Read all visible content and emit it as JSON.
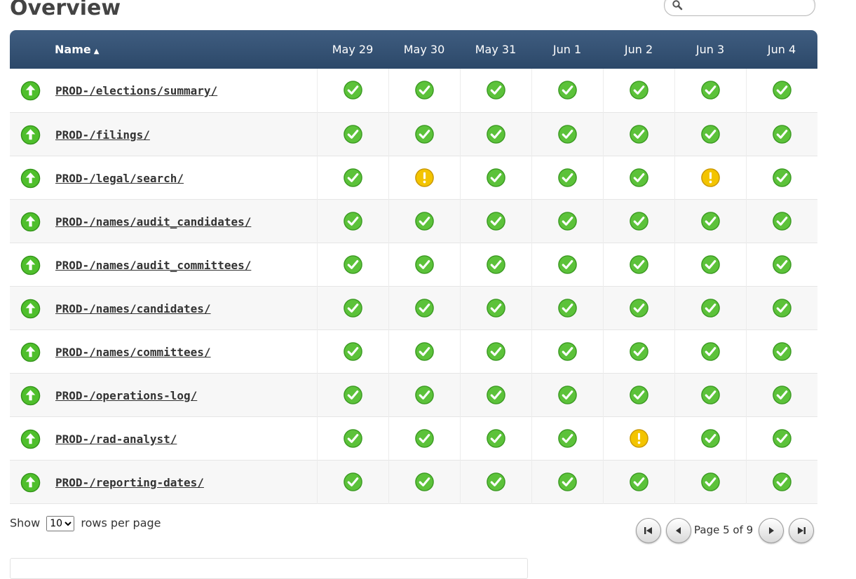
{
  "page": {
    "title": "Overview"
  },
  "search": {
    "placeholder": "",
    "value": ""
  },
  "table": {
    "name_header": "Name",
    "sort_indicator": "▲",
    "dates": [
      "May 29",
      "May 30",
      "May 31",
      "Jun 1",
      "Jun 2",
      "Jun 3",
      "Jun 4"
    ],
    "rows": [
      {
        "name": "PROD-/elections/summary/",
        "current_status": "up",
        "daily": [
          "ok",
          "ok",
          "ok",
          "ok",
          "ok",
          "ok",
          "ok"
        ]
      },
      {
        "name": "PROD-/filings/",
        "current_status": "up",
        "daily": [
          "ok",
          "ok",
          "ok",
          "ok",
          "ok",
          "ok",
          "ok"
        ]
      },
      {
        "name": "PROD-/legal/search/",
        "current_status": "up",
        "daily": [
          "ok",
          "warning",
          "ok",
          "ok",
          "ok",
          "warning",
          "ok"
        ]
      },
      {
        "name": "PROD-/names/audit_candidates/",
        "current_status": "up",
        "daily": [
          "ok",
          "ok",
          "ok",
          "ok",
          "ok",
          "ok",
          "ok"
        ]
      },
      {
        "name": "PROD-/names/audit_committees/",
        "current_status": "up",
        "daily": [
          "ok",
          "ok",
          "ok",
          "ok",
          "ok",
          "ok",
          "ok"
        ]
      },
      {
        "name": "PROD-/names/candidates/",
        "current_status": "up",
        "daily": [
          "ok",
          "ok",
          "ok",
          "ok",
          "ok",
          "ok",
          "ok"
        ]
      },
      {
        "name": "PROD-/names/committees/",
        "current_status": "up",
        "daily": [
          "ok",
          "ok",
          "ok",
          "ok",
          "ok",
          "ok",
          "ok"
        ]
      },
      {
        "name": "PROD-/operations-log/",
        "current_status": "up",
        "daily": [
          "ok",
          "ok",
          "ok",
          "ok",
          "ok",
          "ok",
          "ok"
        ]
      },
      {
        "name": "PROD-/rad-analyst/",
        "current_status": "up",
        "daily": [
          "ok",
          "ok",
          "ok",
          "ok",
          "warning",
          "ok",
          "ok"
        ]
      },
      {
        "name": "PROD-/reporting-dates/",
        "current_status": "up",
        "daily": [
          "ok",
          "ok",
          "ok",
          "ok",
          "ok",
          "ok",
          "ok"
        ]
      }
    ]
  },
  "pagination": {
    "show_label": "Show",
    "rows_value": "10",
    "rows_options": [
      "10"
    ],
    "rows_suffix": "rows per page",
    "page_info": "Page 5 of 9"
  },
  "colors": {
    "header_bg": "#34526f",
    "ok_green": "#5cc23a",
    "warning_yellow": "#f3c400",
    "up_green": "#4fbf2c"
  },
  "icons": {
    "search": "search-icon",
    "up": "up-arrow-icon",
    "ok": "check-icon",
    "warning": "exclamation-icon",
    "first": "first-page-icon",
    "prev": "previous-page-icon",
    "next": "next-page-icon",
    "last": "last-page-icon"
  }
}
